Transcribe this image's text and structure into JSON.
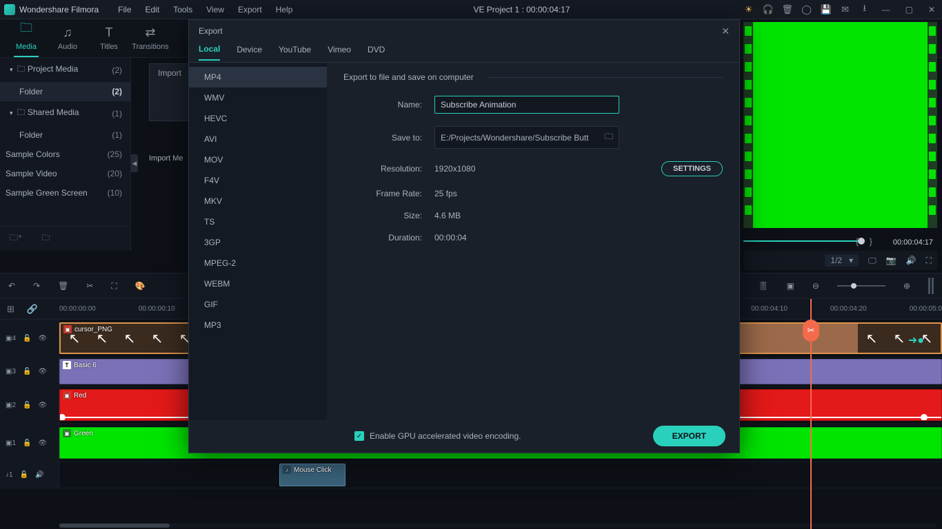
{
  "titlebar": {
    "app": "Wondershare Filmora",
    "menus": [
      "File",
      "Edit",
      "Tools",
      "View",
      "Export",
      "Help"
    ],
    "project": "VE Project 1 : 00:00:04:17"
  },
  "modules": [
    "Media",
    "Audio",
    "Titles",
    "Transitions"
  ],
  "sidebar": {
    "project_media": {
      "label": "Project Media",
      "count": "(2)"
    },
    "folder_active": {
      "label": "Folder",
      "count": "(2)"
    },
    "shared_media": {
      "label": "Shared Media",
      "count": "(1)"
    },
    "folder2": {
      "label": "Folder",
      "count": "(1)"
    },
    "sample_colors": {
      "label": "Sample Colors",
      "count": "(25)"
    },
    "sample_video": {
      "label": "Sample Video",
      "count": "(20)"
    },
    "sample_green": {
      "label": "Sample Green Screen",
      "count": "(10)"
    }
  },
  "import": {
    "btn": "Import",
    "hint": "Import Me"
  },
  "preview": {
    "timecode": "00:00:04:17",
    "zoom": "1/2"
  },
  "ruler": [
    "00:00:00:00",
    "00:00:00:10",
    "00:00:04:10",
    "00:00:04:20",
    "00:00:05:0"
  ],
  "tracks": {
    "t4": "4",
    "t3": "3",
    "t2": "2",
    "t1": "1",
    "a1": "1",
    "clip_cursor": "cursor_PNG",
    "clip_basic": "Basic 6",
    "clip_red": "Red",
    "clip_green": "Green",
    "clip_mouse": "Mouse Click"
  },
  "dialog": {
    "title": "Export",
    "tabs": [
      "Local",
      "Device",
      "YouTube",
      "Vimeo",
      "DVD"
    ],
    "formats": [
      "MP4",
      "WMV",
      "HEVC",
      "AVI",
      "MOV",
      "F4V",
      "MKV",
      "TS",
      "3GP",
      "MPEG-2",
      "WEBM",
      "GIF",
      "MP3"
    ],
    "heading": "Export to file and save on computer",
    "name_label": "Name:",
    "name_value": "Subscribe Animation",
    "save_label": "Save to:",
    "save_value": "E:/Projects/Wondershare/Subscribe Butt",
    "res_label": "Resolution:",
    "res_value": "1920x1080",
    "settings_btn": "SETTINGS",
    "fr_label": "Frame Rate:",
    "fr_value": "25 fps",
    "size_label": "Size:",
    "size_value": "4.6 MB",
    "dur_label": "Duration:",
    "dur_value": "00:00:04",
    "gpu_label": "Enable GPU accelerated video encoding.",
    "export_btn": "EXPORT"
  }
}
